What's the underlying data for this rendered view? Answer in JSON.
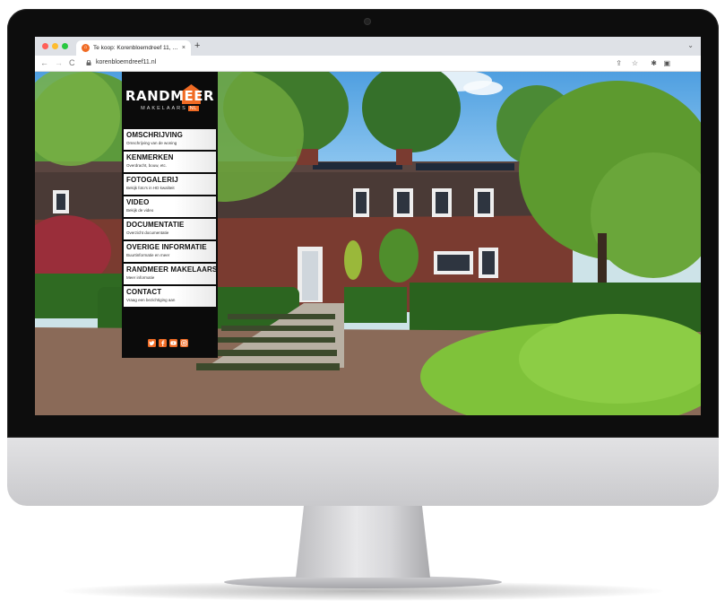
{
  "browser": {
    "tab_title": "Te koop: Korenbloemdreef 11, …",
    "tab_close": "×",
    "new_tab": "+",
    "url": "korenbloemdreef11.nl"
  },
  "site": {
    "logo_main": "RANDMEER",
    "logo_sub": "MAKELAARS",
    "logo_nl": "NL",
    "menu": [
      {
        "title": "OMSCHRIJVING",
        "subtitle": "Omschrijving van de woning"
      },
      {
        "title": "KENMERKEN",
        "subtitle": "Overdracht, bouw, etc."
      },
      {
        "title": "FOTOGALERIJ",
        "subtitle": "Bekijk foto's in HD kwaliteit"
      },
      {
        "title": "VIDEO",
        "subtitle": "Bekijk de video"
      },
      {
        "title": "DOCUMENTATIE",
        "subtitle": "Overzicht documentatie"
      },
      {
        "title": "OVERIGE INFORMATIE",
        "subtitle": "Buurtinformatie en meer"
      },
      {
        "title": "RANDMEER MAKELAARS",
        "subtitle": "Meer informatie"
      },
      {
        "title": "CONTACT",
        "subtitle": "Vraag een bezichtiging aan"
      }
    ],
    "socials": [
      "twitter-icon",
      "facebook-icon",
      "youtube-icon",
      "instagram-icon"
    ],
    "accent_color": "#f06b24"
  }
}
